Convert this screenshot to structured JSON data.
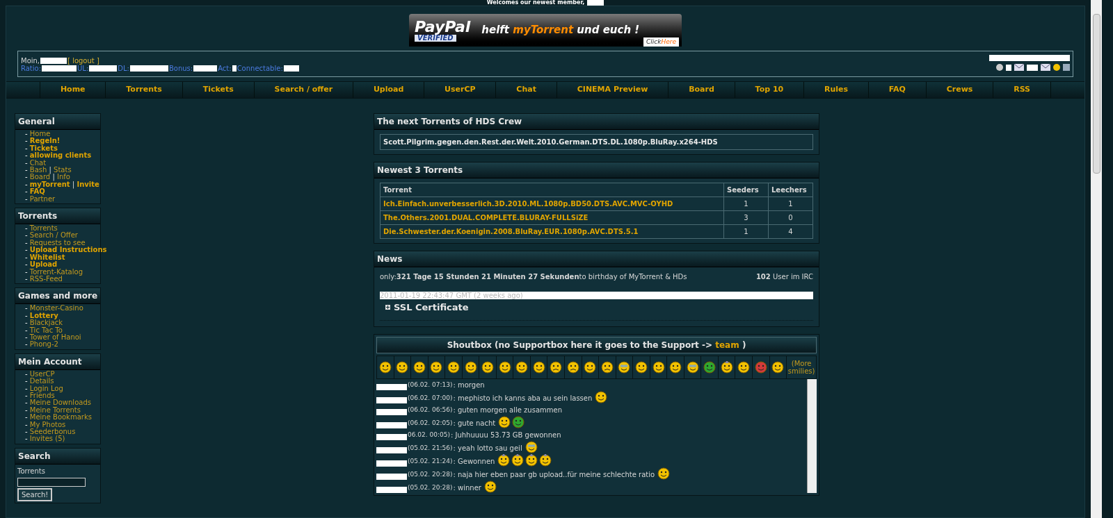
{
  "welcome": {
    "text": "Welcomes our newest member,"
  },
  "banner": {
    "brand": "PayPal",
    "badge": "VERIFIED",
    "slogan_pre": "helft",
    "slogan_brand": "myTorrent",
    "slogan_post": "und euch !",
    "cta_pre": "Click",
    "cta": "Here"
  },
  "user_box": {
    "greeting": "Moin,",
    "logout": "[ logout ]",
    "stats": [
      "Ratio:",
      "UL:",
      "DL:",
      "Bonus:",
      "Act:",
      "Connectable:"
    ]
  },
  "nav": [
    "Home",
    "Torrents",
    "Tickets",
    "Search / offer",
    "Upload",
    "UserCP",
    "Chat",
    "CINEMA Preview",
    "Board",
    "Top 10",
    "Rules",
    "FAQ",
    "Crews",
    "RSS"
  ],
  "sidebar": [
    {
      "title": "General",
      "bullet": "-",
      "separator": "|",
      "items": [
        [
          {
            "label": "Home",
            "bold": false
          }
        ],
        [
          {
            "label": "Regeln!",
            "bold": true
          }
        ],
        [
          {
            "label": "Tickets",
            "bold": true
          }
        ],
        [
          {
            "label": "allowing clients",
            "bold": true
          }
        ],
        [
          {
            "label": "Chat",
            "bold": false
          }
        ],
        [
          {
            "label": "Bash",
            "bold": false
          },
          {
            "label": "Stats",
            "bold": false
          }
        ],
        [
          {
            "label": "Board",
            "bold": false
          },
          {
            "label": "Info",
            "bold": false
          }
        ],
        [
          {
            "label": "myTorrent",
            "bold": true
          },
          {
            "label": "Invite",
            "bold": true
          }
        ],
        [
          {
            "label": "FAQ",
            "bold": true
          }
        ],
        [
          {
            "label": "Partner",
            "bold": false
          }
        ]
      ]
    },
    {
      "title": "Torrents",
      "bullet": "-",
      "items": [
        [
          {
            "label": "Torrents",
            "bold": false
          }
        ],
        [
          {
            "label": "Search / Offer",
            "bold": false
          }
        ],
        [
          {
            "label": "Requests to see",
            "bold": false
          }
        ],
        [
          {
            "label": "Upload Instructions",
            "bold": true
          }
        ],
        [
          {
            "label": "Whitelist",
            "bold": true
          }
        ],
        [
          {
            "label": "Upload",
            "bold": true
          }
        ],
        [
          {
            "label": "Torrent-Katalog",
            "bold": false
          }
        ],
        [
          {
            "label": "RSS-Feed",
            "bold": false
          }
        ]
      ]
    },
    {
      "title": "Games and more",
      "bullet": "-",
      "items": [
        [
          {
            "label": "Monster-Casino",
            "bold": false
          }
        ],
        [
          {
            "label": "Lottery",
            "bold": true
          }
        ],
        [
          {
            "label": "Blackjack",
            "bold": false
          }
        ],
        [
          {
            "label": "Tic Tac To",
            "bold": false
          }
        ],
        [
          {
            "label": "Tower of Hanoi",
            "bold": false
          }
        ],
        [
          {
            "label": "Phong-2",
            "bold": false
          }
        ]
      ]
    },
    {
      "title": "Mein Account",
      "bullet": "-",
      "items": [
        [
          {
            "label": "UserCP",
            "bold": false
          }
        ],
        [
          {
            "label": "Details",
            "bold": false
          }
        ],
        [
          {
            "label": "Login Log",
            "bold": false
          }
        ],
        [
          {
            "label": "Friends",
            "bold": false
          }
        ],
        [
          {
            "label": "Meine Downloads",
            "bold": false
          }
        ],
        [
          {
            "label": "Meine Torrents",
            "bold": false
          }
        ],
        [
          {
            "label": "Meine Bookmarks",
            "bold": false
          }
        ],
        [
          {
            "label": "My Photos",
            "bold": false
          }
        ],
        [
          {
            "label": "Seederbonus",
            "bold": false
          }
        ],
        [
          {
            "label": "Invites (5)",
            "bold": false
          }
        ]
      ]
    }
  ],
  "search": {
    "title": "Search",
    "label": "Torrents",
    "button": "Search!"
  },
  "next_torrents": {
    "title": "The next Torrents of HDS Crew",
    "items": [
      "Scott.Pilgrim.gegen.den.Rest.der.Welt.2010.German.DTS.DL.1080p.BluRay.x264-HDS"
    ]
  },
  "newest": {
    "title": "Newest 3 Torrents",
    "columns": [
      "Torrent",
      "Seeders",
      "Leechers"
    ],
    "rows": [
      [
        "Ich.Einfach.unverbesserlich.3D.2010.ML.1080p.BD50.DTS.AVC.MVC-OYHD",
        "1",
        "1"
      ],
      [
        "The.Others.2001.DUAL.COMPLETE.BLURAY-FULLSiZE",
        "3",
        "0"
      ],
      [
        "Die.Schwester.der.Koenigin.2008.BluRay.EUR.1080p.AVC.DTS.5.1",
        "1",
        "4"
      ]
    ]
  },
  "news": {
    "title": "News",
    "countdown": "only:**321 Tage 15 Stunden 21 Minuten 27 Sekunden**to birthday of MyTorrent & HDs",
    "irc": "**102** User im IRC",
    "date": "2011-01-19 22:43:47 GMT (2 weeks ago)",
    "headline": "SSL Certificate",
    "expanded": false
  },
  "shoutbox": {
    "title": "Shoutbox (no Supportbox here it goes to the Support ->",
    "link": "team",
    "title_end": ")",
    "smilies": [
      {
        "kind": "smile"
      },
      {
        "kind": "grin"
      },
      {
        "kind": "laugh"
      },
      {
        "kind": "grin"
      },
      {
        "kind": "shock"
      },
      {
        "kind": "tongue"
      },
      {
        "kind": "wink"
      },
      {
        "kind": "neutral"
      },
      {
        "kind": "confused"
      },
      {
        "kind": "worried"
      },
      {
        "kind": "cry"
      },
      {
        "kind": "sad"
      },
      {
        "kind": "shock"
      },
      {
        "kind": "angry"
      },
      {
        "kind": "cool"
      },
      {
        "kind": "shock"
      },
      {
        "kind": "sleepy"
      },
      {
        "kind": "crazy"
      },
      {
        "kind": "sunglasses"
      },
      {
        "kind": "sick"
      },
      {
        "kind": "wizard"
      },
      {
        "kind": "shock"
      },
      {
        "kind": "curse"
      },
      {
        "kind": "smile"
      }
    ],
    "more": "(More smilies)",
    "messages": [
      {
        "time": "(06.02. 07:13)",
        "text": ": morgen"
      },
      {
        "time": "(06.02. 07:00)",
        "text": ": mephisto ich kanns aba au sein lassen",
        "emotes": [
          {
            "kind": "crazy"
          }
        ]
      },
      {
        "time": "(06.02. 06:56)",
        "text": ": guten morgen alle zusammen"
      },
      {
        "time": "(06.02. 02:05)",
        "text": ": gute nacht",
        "emotes": [
          {
            "kind": "smile"
          },
          {
            "kind": "frog"
          }
        ]
      },
      {
        "time": "06.02. 00:05)",
        "text": ": Juhhuuuu 53.73 GB gewonnen"
      },
      {
        "time": "(05.02. 21:56)",
        "text": ": yeah lotto sau geil",
        "emotes": [
          {
            "kind": "cool"
          }
        ]
      },
      {
        "time": "(05.02. 21:24)",
        "text": ": Gewonnen",
        "emotes": [
          {
            "kind": "wizard"
          },
          {
            "kind": "wizard"
          },
          {
            "kind": "wizard"
          },
          {
            "kind": "wizard"
          }
        ]
      },
      {
        "time": "(05.02. 20:28)",
        "text": ": naja hier eben paar gb upload..für meine schlechte ratio",
        "emotes": [
          {
            "kind": "laugh"
          }
        ]
      },
      {
        "time": "(05.02. 20:28)",
        "text": ": winner",
        "emotes": [
          {
            "kind": "laugh"
          }
        ]
      }
    ]
  }
}
